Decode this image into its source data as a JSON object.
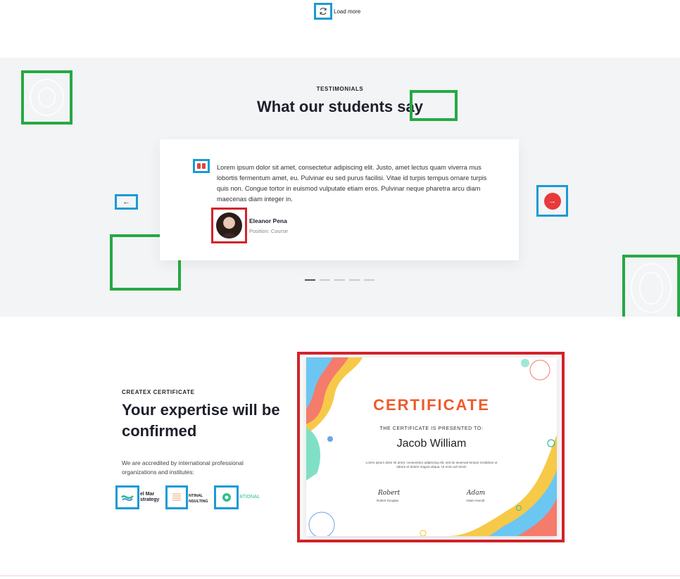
{
  "load_more": {
    "label": "Load more",
    "icon": "refresh-icon"
  },
  "testimonials": {
    "eyebrow": "TESTIMONIALS",
    "title": "What our students say",
    "quote": "Lorem ipsum dolor sit amet, consectetur adipiscing elit. Justo, amet lectus quam viverra mus lobortis fermentum amet, eu. Pulvinar eu sed purus facilisi. Vitae id turpis tempus ornare turpis quis non. Congue tortor in euismod vulputate etiam eros. Pulvinar neque pharetra arcu diam maecenas diam integer in.",
    "author_name": "Eleanor Pena",
    "author_position": "Position: Course",
    "prev_label": "←",
    "next_label": "→",
    "slides": 5,
    "active_slide": 1
  },
  "certificate_section": {
    "eyebrow": "CREATEX CERTIFICATE",
    "title": "Your expertise will be confirmed",
    "description": "We are accredited by international professional organizations and institutes:",
    "partners": [
      {
        "text": "el Mar\nstrategy",
        "icon": "swirl-logo-icon"
      },
      {
        "text": "NTINAL\nNSULTING",
        "icon": "lines-logo-icon"
      },
      {
        "text": "ATIONAL",
        "icon": "circle-logo-icon"
      }
    ]
  },
  "certificate": {
    "title": "CERTIFICATE",
    "presented_to": "THE CERTIFICATE IS PRESENTED TO:",
    "name": "Jacob William",
    "body": "Lorem ipsum dolor sit amet, consectetur adipiscing elit, sed do eiusmod tempor incididunt ut labore et dolore magna aliqua. Ut enim ad minim",
    "signatures": [
      {
        "signature": "Robert",
        "name": "Robert Douglas"
      },
      {
        "signature": "Adam",
        "name": "Adam Harold"
      }
    ]
  },
  "colors": {
    "accent_red": "#e83a3a",
    "annotation_blue": "#1a9ad6",
    "annotation_green": "#27a844",
    "annotation_red": "#d3232a",
    "certificate_orange": "#ef5a2a"
  }
}
